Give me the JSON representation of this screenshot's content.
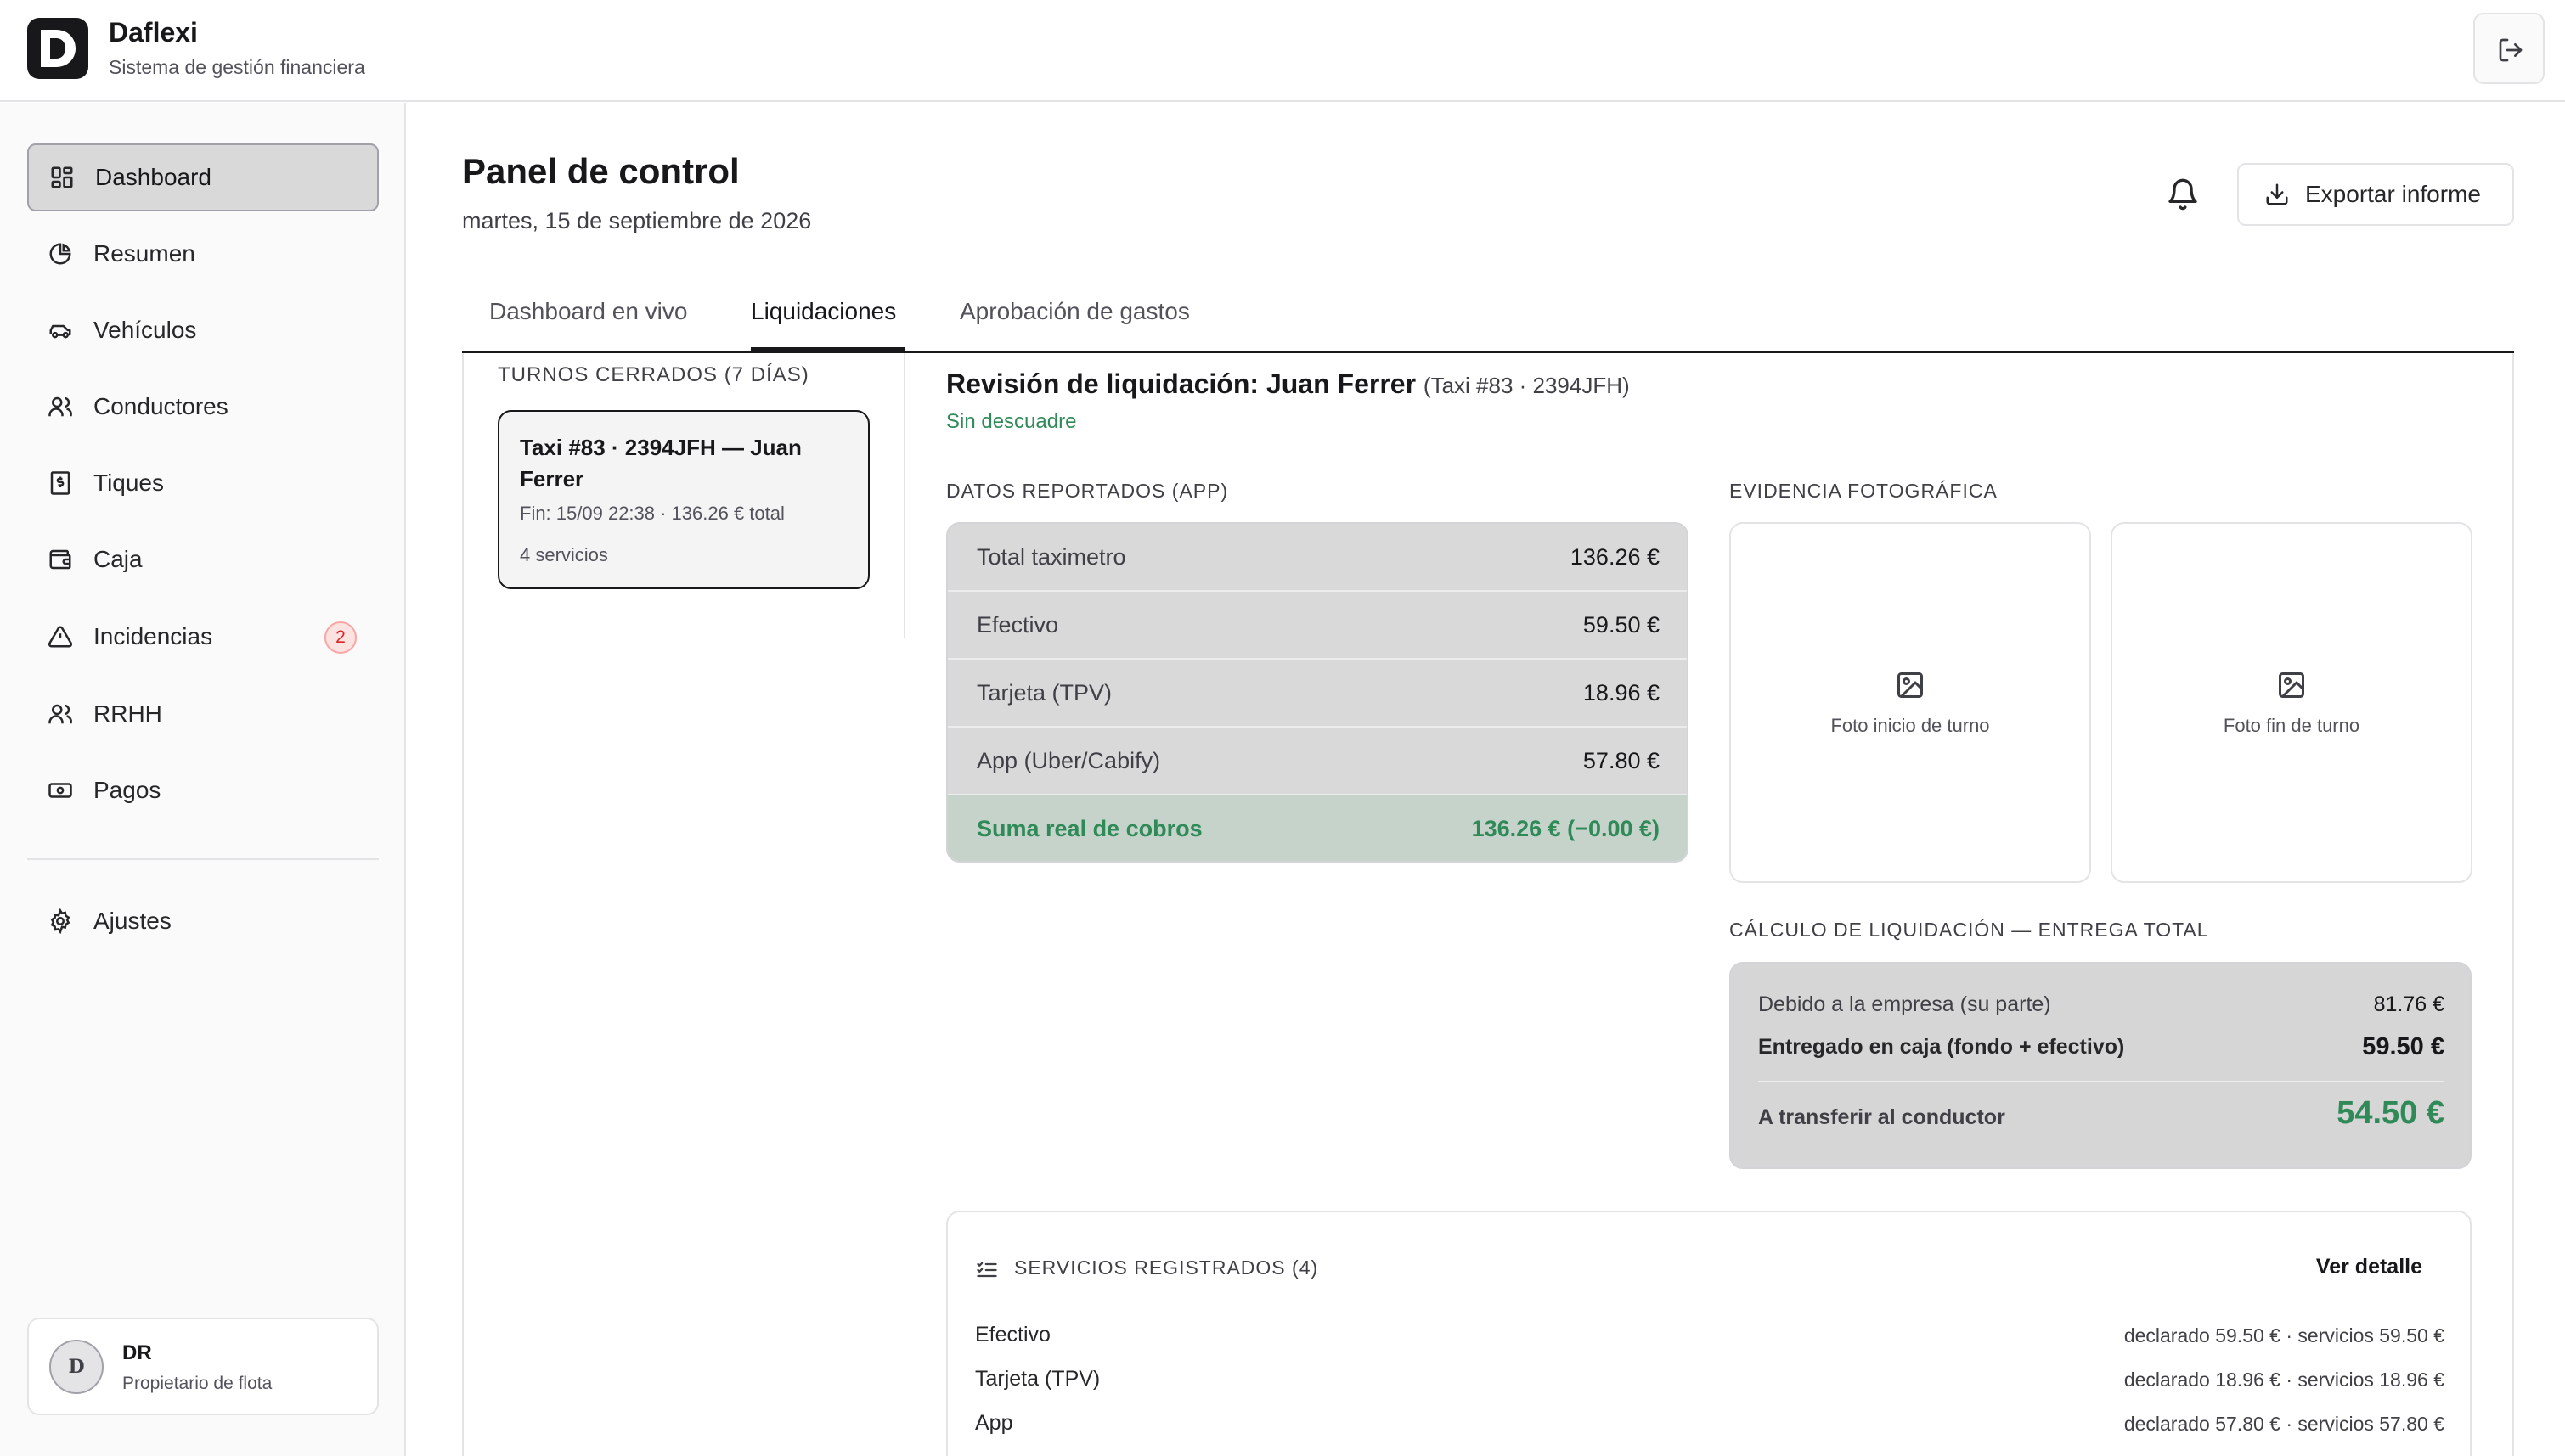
{
  "app": {
    "name": "Daflexi",
    "subtitle": "Sistema de gestión financiera"
  },
  "sidebar": {
    "items": [
      {
        "label": "Dashboard",
        "icon": "dashboard-grid-icon",
        "active": true
      },
      {
        "label": "Resumen",
        "icon": "pie-chart-icon"
      },
      {
        "label": "Vehículos",
        "icon": "car-icon"
      },
      {
        "label": "Conductores",
        "icon": "users-icon"
      },
      {
        "label": "Tiques",
        "icon": "receipt-icon"
      },
      {
        "label": "Caja",
        "icon": "wallet-icon"
      },
      {
        "label": "Incidencias",
        "icon": "alert-triangle-icon",
        "badge": "2"
      },
      {
        "label": "RRHH",
        "icon": "users-icon"
      },
      {
        "label": "Pagos",
        "icon": "banknote-icon"
      }
    ],
    "settings": {
      "label": "Ajustes",
      "icon": "gear-icon"
    },
    "user": {
      "avatar": "D",
      "name": "DR",
      "role": "Propietario de flota"
    }
  },
  "header": {
    "title": "Panel de control",
    "date": "martes, 15 de septiembre de 2026",
    "export_label": "Exportar informe"
  },
  "tabs": [
    {
      "label": "Dashboard en vivo"
    },
    {
      "label": "Liquidaciones",
      "active": true
    },
    {
      "label": "Aprobación de gastos"
    }
  ],
  "shifts": {
    "heading": "TURNOS CERRADOS (7 DÍAS)",
    "items": [
      {
        "title": "Taxi #83 · 2394JFH — Juan Ferrer",
        "meta": "Fin: 15/09 22:38 · 136.26 € total",
        "count": "4 servicios"
      }
    ]
  },
  "review": {
    "title": "Revisión de liquidación: Juan Ferrer",
    "vehicle": "(Taxi #83 · 2394JFH)",
    "status": "Sin descuadre",
    "reported_heading": "DATOS REPORTADOS (APP)",
    "reported": [
      {
        "label": "Total taximetro",
        "value": "136.26 €"
      },
      {
        "label": "Efectivo",
        "value": "59.50 €"
      },
      {
        "label": "Tarjeta (TPV)",
        "value": "18.96 €"
      },
      {
        "label": "App (Uber/Cabify)",
        "value": "57.80 €"
      }
    ],
    "reported_total": {
      "label": "Suma real de cobros",
      "value": "136.26 € (−0.00 €)"
    },
    "photos_heading": "EVIDENCIA FOTOGRÁFICA",
    "photos": [
      {
        "caption": "Foto inicio de turno"
      },
      {
        "caption": "Foto fin de turno"
      }
    ],
    "settlement_heading": "CÁLCULO DE LIQUIDACIÓN — ENTREGA TOTAL",
    "settlement": {
      "due_label": "Debido a la empresa (su parte)",
      "due_value": "81.76 €",
      "delivered_label": "Entregado en caja (fondo + efectivo)",
      "delivered_value": "59.50 €",
      "transfer_label": "A transferir al conductor",
      "transfer_value": "54.50 €"
    },
    "services": {
      "title": "SERVICIOS REGISTRADOS (4)",
      "link": "Ver detalle",
      "rows": [
        {
          "label": "Efectivo",
          "value": "declarado 59.50 € · servicios 59.50 €"
        },
        {
          "label": "Tarjeta (TPV)",
          "value": "declarado 18.96 € · servicios 18.96 €"
        },
        {
          "label": "App",
          "value": "declarado 57.80 € · servicios 57.80 €"
        }
      ]
    }
  },
  "colors": {
    "accent": "#18181b",
    "success": "#2f8a58",
    "danger": "#dc2626",
    "panel": "#d9d9d9"
  }
}
